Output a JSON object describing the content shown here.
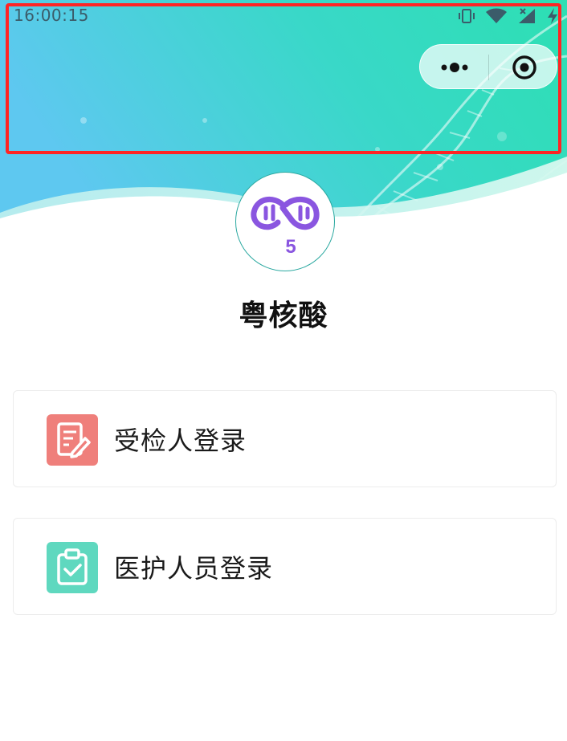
{
  "status_bar": {
    "time": "16:00:15",
    "icons": [
      "vibrate-icon",
      "wifi-icon",
      "signal-icon",
      "charging-icon"
    ]
  },
  "capsule": {
    "more_icon": "more-dots-icon",
    "close_icon": "target-close-icon"
  },
  "app": {
    "name": "粤核酸",
    "logo_digit": "5"
  },
  "login_options": [
    {
      "label": "受检人登录",
      "icon": "edit-document-icon",
      "color": "#ef7f7b"
    },
    {
      "label": "医护人员登录",
      "icon": "clipboard-check-icon",
      "color": "#5fd8bf"
    }
  ],
  "colors": {
    "banner_start": "#5ec8f0",
    "banner_end": "#2ddfb3",
    "logo_purple": "#8a56e0",
    "logo_border": "#2aa8a0",
    "highlight": "#ff2424"
  }
}
